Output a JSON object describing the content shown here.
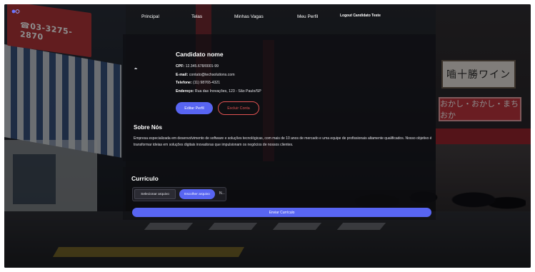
{
  "colors": {
    "accent": "#5865f2",
    "danger": "#e05252"
  },
  "nav": {
    "items": [
      "Principal",
      "Telas",
      "Minhas Vagas",
      "Meu Perfil"
    ],
    "logout": "Logout Candidato Teste"
  },
  "background_signs": {
    "phone": "☎03-3275-2870",
    "wine": "嚙十勝ワイン",
    "okashi": "おかし・おかし・まちおか"
  },
  "profile": {
    "name": "Candidato nome",
    "cpf_label": "CPF:",
    "cpf_value": "12.345.678/0001-99",
    "email_label": "E-mail:",
    "email_value": "contato@techsolutions.com",
    "phone_label": "Telefone:",
    "phone_value": "(11) 98765-4321",
    "address_label": "Endereço:",
    "address_value": "Rua das Inovações, 123 - São Paulo/SP",
    "edit_button": "Editar Perfil",
    "delete_button": "Excluir Conta"
  },
  "about": {
    "title": "Sobre Nós",
    "text": "Empresa especializada em desenvolvimento de software e soluções tecnológicas, com mais de 10 anos de mercado e uma equipe de profissionais altamente qualificados. Nosso objetivo é transformar ideias em soluções digitais inovadoras que impulsionam os negócios de nossos clientes."
  },
  "curriculum": {
    "title": "Currículo",
    "select_button": "Selecionar arquivo",
    "choose_button": "Escolher arquivo",
    "file_name": "N...",
    "send_button": "Enviar Currículo"
  }
}
